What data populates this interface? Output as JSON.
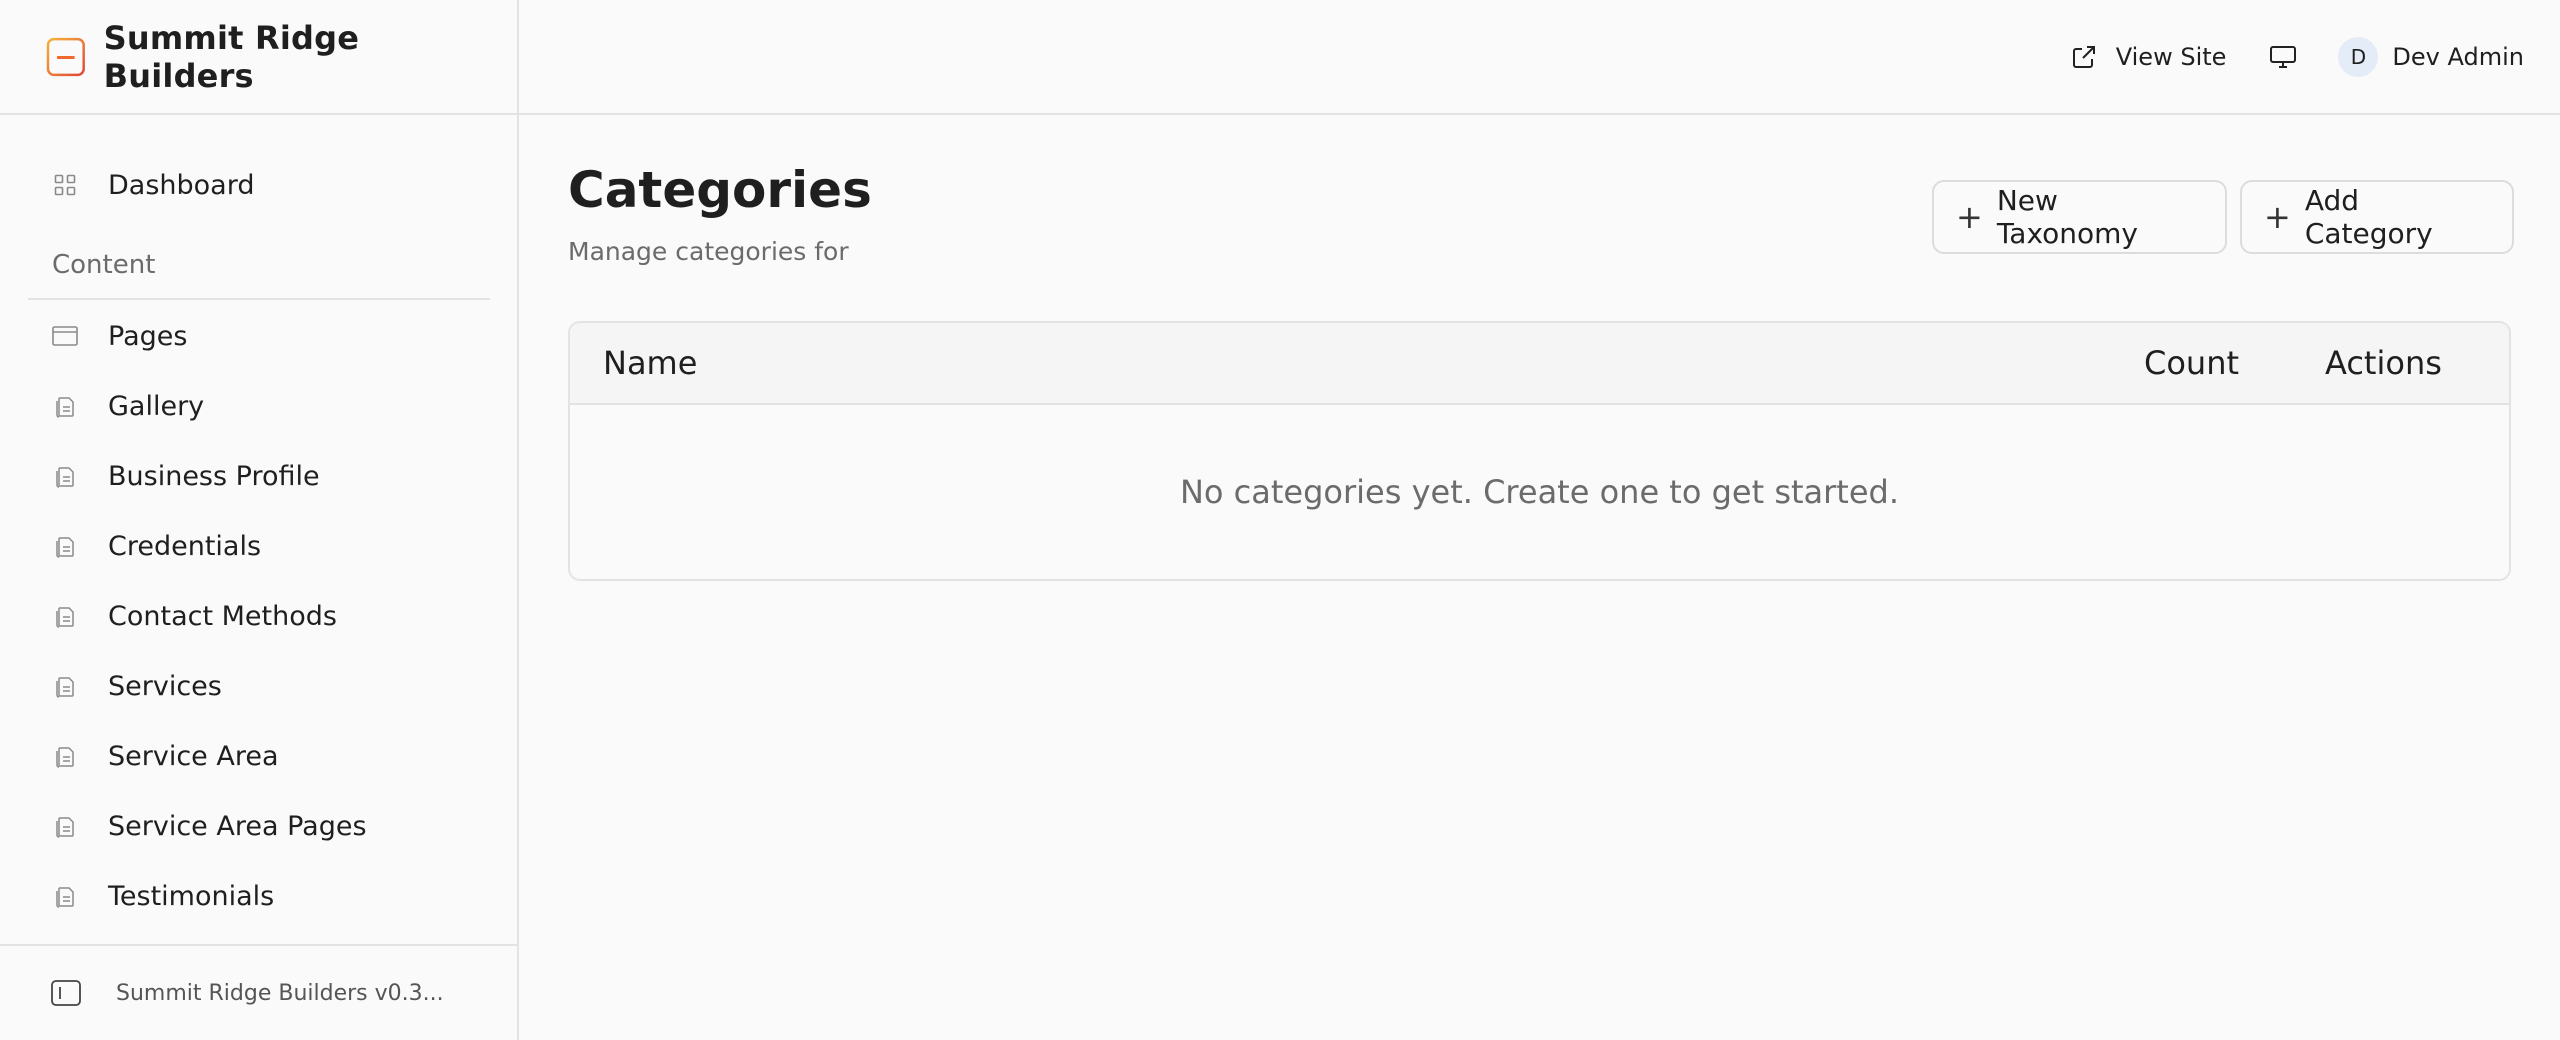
{
  "brand": {
    "name": "Summit Ridge Builders",
    "logo_icon": "brand-logo-icon",
    "accent": "#f08a24"
  },
  "sidebar": {
    "dashboard": {
      "label": "Dashboard",
      "icon": "grid-icon"
    },
    "section_label": "Content",
    "items": [
      {
        "label": "Pages",
        "icon": "window-icon"
      },
      {
        "label": "Gallery",
        "icon": "document-icon"
      },
      {
        "label": "Business Profile",
        "icon": "document-icon"
      },
      {
        "label": "Credentials",
        "icon": "document-icon"
      },
      {
        "label": "Contact Methods",
        "icon": "document-icon"
      },
      {
        "label": "Services",
        "icon": "document-icon"
      },
      {
        "label": "Service Area",
        "icon": "document-icon"
      },
      {
        "label": "Service Area Pages",
        "icon": "document-icon"
      },
      {
        "label": "Testimonials",
        "icon": "document-icon"
      }
    ],
    "footer": {
      "label": "Summit Ridge Builders v0.3...",
      "icon": "sidebar-toggle-icon"
    }
  },
  "topbar": {
    "view_site": "View Site",
    "user_initial": "D",
    "user_name": "Dev Admin"
  },
  "main": {
    "title": "Categories",
    "subtitle": "Manage categories for",
    "buttons": {
      "new_taxonomy": "New Taxonomy",
      "add_category": "Add Category"
    },
    "table": {
      "columns": [
        "Name",
        "Count",
        "Actions"
      ],
      "empty_message": "No categories yet. Create one to get started."
    }
  }
}
